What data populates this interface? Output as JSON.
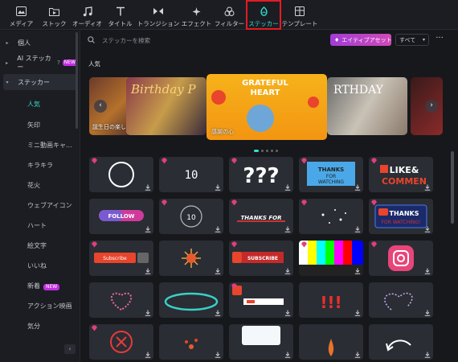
{
  "toolbar": {
    "tabs": [
      {
        "label": "メディア",
        "icon": "media-icon"
      },
      {
        "label": "ストック",
        "icon": "stock-icon"
      },
      {
        "label": "オーディオ",
        "icon": "audio-icon"
      },
      {
        "label": "タイトル",
        "icon": "title-icon"
      },
      {
        "label": "トランジション",
        "icon": "transition-icon"
      },
      {
        "label": "エフェクト",
        "icon": "effect-icon"
      },
      {
        "label": "フィルター",
        "icon": "filter-icon"
      },
      {
        "label": "ステッカー",
        "icon": "sticker-icon",
        "active": true
      },
      {
        "label": "テンプレート",
        "icon": "template-icon"
      }
    ]
  },
  "sidebar": {
    "groups": [
      {
        "label": "個人"
      },
      {
        "label": "AI ステッカー",
        "badge": "NEW"
      },
      {
        "label": "ステッカー",
        "expanded": true
      }
    ],
    "items": [
      "人気",
      "矢印",
      "ミニ動画キャ...",
      "キラキラ",
      "花火",
      "ウェブアイコン",
      "ハート",
      "絵文字",
      "いいね",
      "新着",
      "アクション映画",
      "気分"
    ],
    "new_badge": "NEW"
  },
  "main": {
    "search_placeholder": "ステッカーを検索",
    "asset_button": "エイティブアセットを",
    "filter_value": "すべて",
    "section_title": "人気",
    "carousel": {
      "cards": [
        {
          "caption": "誕生日の楽しみ"
        },
        {
          "caption": "感謝の心"
        }
      ],
      "center_text": "GRATEFUL HEART",
      "left_text": "Birthday P",
      "right_text": "RTHDAY"
    },
    "tiles": [
      {
        "label": ""
      },
      {
        "label": "10"
      },
      {
        "label": "???"
      },
      {
        "label": "THANKS FOR WATCHING"
      },
      {
        "label": "LIKE & COMMENT"
      },
      {
        "label": "FOLLOW"
      },
      {
        "label": "10"
      },
      {
        "label": "THANKS FOR"
      },
      {
        "label": ""
      },
      {
        "label": "THANKS FOR WATCHING"
      },
      {
        "label": "Subscribe"
      },
      {
        "label": ""
      },
      {
        "label": "SUBSCRIBE"
      },
      {
        "label": ""
      },
      {
        "label": ""
      },
      {
        "label": ""
      },
      {
        "label": ""
      },
      {
        "label": ""
      },
      {
        "label": "!!!"
      },
      {
        "label": ""
      },
      {
        "label": ""
      },
      {
        "label": ""
      },
      {
        "label": ""
      },
      {
        "label": ""
      },
      {
        "label": ""
      }
    ]
  },
  "colors": {
    "accent": "#2fe0d0",
    "active_outline": "#e31b23",
    "premium": "#e0407a"
  }
}
